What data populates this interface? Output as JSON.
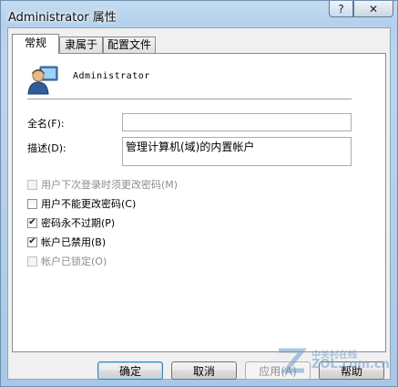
{
  "window": {
    "title": "Administrator 属性",
    "help_glyph": "?",
    "close_glyph": "✕"
  },
  "tabs": [
    {
      "label": "常规",
      "active": true
    },
    {
      "label": "隶属于",
      "active": false
    },
    {
      "label": "配置文件",
      "active": false
    }
  ],
  "user": {
    "name": "Administrator",
    "icon": "user-icon"
  },
  "fields": {
    "fullname_label": "全名(F):",
    "fullname_value": "",
    "description_label": "描述(D):",
    "description_value": "管理计算机(域)的内置帐户"
  },
  "checkboxes": [
    {
      "label": "用户下次登录时须更改密码(M)",
      "checked": false,
      "disabled": true
    },
    {
      "label": "用户不能更改密码(C)",
      "checked": false,
      "disabled": false
    },
    {
      "label": "密码永不过期(P)",
      "checked": true,
      "disabled": false
    },
    {
      "label": "帐户已禁用(B)",
      "checked": true,
      "disabled": false
    },
    {
      "label": "帐户已锁定(O)",
      "checked": false,
      "disabled": true
    }
  ],
  "buttons": {
    "ok": "确定",
    "cancel": "取消",
    "apply": "应用(A)",
    "help": "帮助"
  },
  "watermark": {
    "line1": "中关村在线",
    "line2": "ZOL.com.cn"
  }
}
